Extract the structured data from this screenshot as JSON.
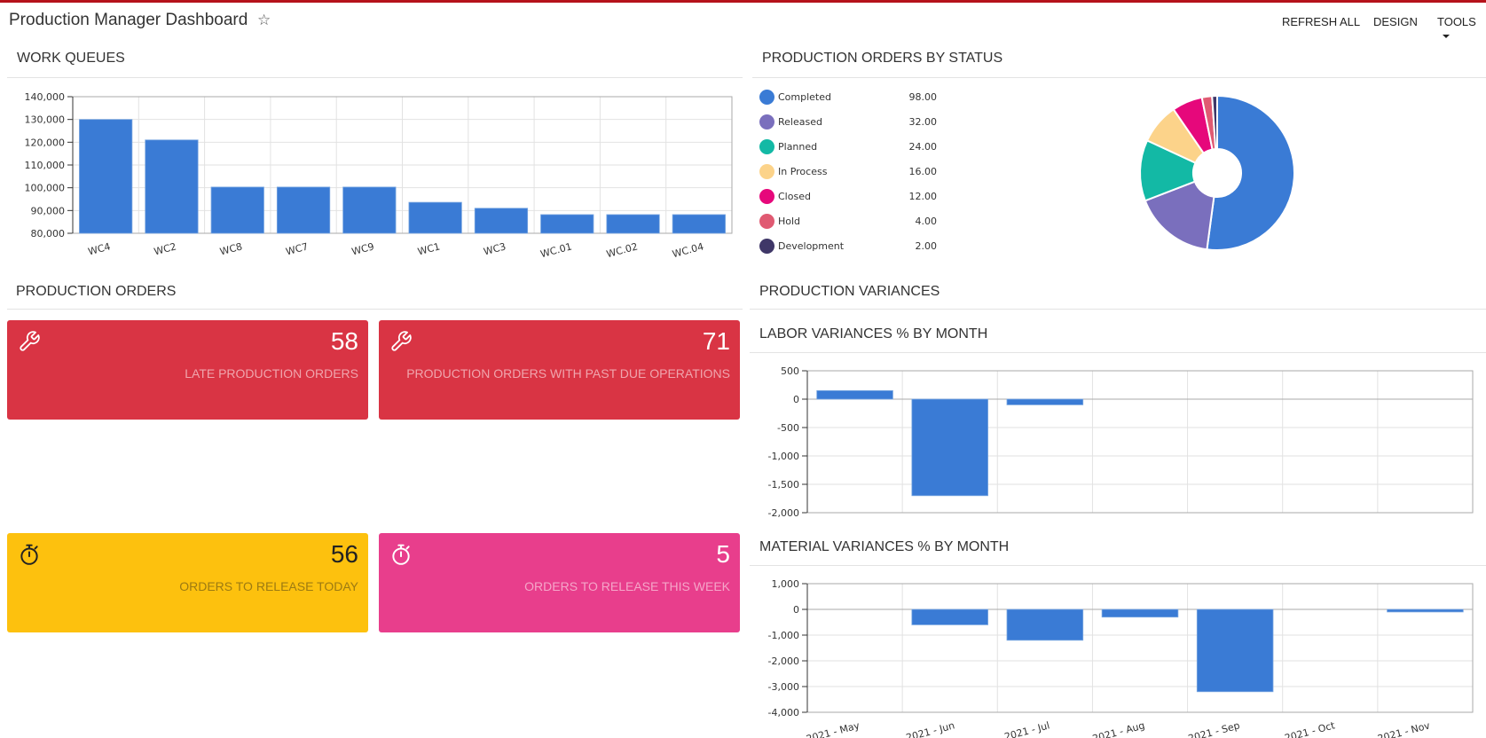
{
  "header": {
    "title": "Production Manager Dashboard",
    "star_icon": "star-outline-icon",
    "actions": [
      {
        "label": "REFRESH ALL"
      },
      {
        "label": "DESIGN"
      },
      {
        "label": "TOOLS",
        "has_dropdown": true
      }
    ]
  },
  "sections": {
    "work_queues": "WORK QUEUES",
    "orders_by_status": "PRODUCTION ORDERS BY STATUS",
    "production_orders": "PRODUCTION ORDERS",
    "production_variances": "PRODUCTION VARIANCES",
    "labor_variances": "LABOR VARIANCES % BY MONTH",
    "material_variances": "MATERIAL VARIANCES % BY MONTH"
  },
  "tiles": [
    {
      "icon": "wrench-icon",
      "value": "58",
      "label": "LATE PRODUCTION ORDERS",
      "color": "#d93444",
      "text_color": "#ffffff",
      "label_color": "#f0a5ad"
    },
    {
      "icon": "wrench-icon",
      "value": "71",
      "label": "PRODUCTION ORDERS WITH PAST DUE OPERATIONS",
      "color": "#d93444",
      "text_color": "#ffffff",
      "label_color": "#f0a5ad"
    },
    {
      "icon": "stopwatch-icon",
      "value": "56",
      "label": "ORDERS TO RELEASE TODAY",
      "color": "#fdc10e",
      "text_color": "#222222",
      "label_color": "#9c7a12"
    },
    {
      "icon": "stopwatch-icon",
      "value": "5",
      "label": "ORDERS TO RELEASE THIS WEEK",
      "color": "#e83e8c",
      "text_color": "#ffffff",
      "label_color": "#f5a6c9"
    }
  ],
  "status_legend": [
    {
      "label": "Completed",
      "value": "98.00",
      "color": "#3a7bd5"
    },
    {
      "label": "Released",
      "value": "32.00",
      "color": "#7a6fbd"
    },
    {
      "label": "Planned",
      "value": "24.00",
      "color": "#13b9a5"
    },
    {
      "label": "In Process",
      "value": "16.00",
      "color": "#fcd38a"
    },
    {
      "label": "Closed",
      "value": "12.00",
      "color": "#e6087b"
    },
    {
      "label": "Hold",
      "value": "4.00",
      "color": "#e05a72"
    },
    {
      "label": "Development",
      "value": "2.00",
      "color": "#3f3768"
    }
  ],
  "chart_data": [
    {
      "id": "work_queues",
      "type": "bar",
      "title": "WORK QUEUES",
      "categories": [
        "WC4",
        "WC2",
        "WC8",
        "WC7",
        "WC9",
        "WC1",
        "WC3",
        "WC.01",
        "WC.02",
        "WC.04"
      ],
      "values": [
        130000,
        121000,
        100300,
        100300,
        100300,
        93600,
        91000,
        88200,
        88200,
        88200
      ],
      "ylim": [
        80000,
        140000
      ],
      "yticks": [
        80000,
        90000,
        100000,
        110000,
        120000,
        130000,
        140000
      ],
      "ytick_labels": [
        "80,000",
        "90,000",
        "100,000",
        "110,000",
        "120,000",
        "130,000",
        "140,000"
      ],
      "grid": true,
      "color": "#3a7bd5"
    },
    {
      "id": "orders_by_status",
      "type": "pie",
      "title": "PRODUCTION ORDERS BY STATUS",
      "donut": true,
      "categories": [
        "Completed",
        "Released",
        "Planned",
        "In Process",
        "Closed",
        "Hold",
        "Development"
      ],
      "values": [
        98,
        32,
        24,
        16,
        12,
        4,
        2
      ],
      "colors": [
        "#3a7bd5",
        "#7a6fbd",
        "#13b9a5",
        "#fcd38a",
        "#e6087b",
        "#e05a72",
        "#3f3768"
      ],
      "legend": "left"
    },
    {
      "id": "labor_variances",
      "type": "bar",
      "title": "LABOR VARIANCES % BY MONTH",
      "categories": [
        "2021 - May",
        "2021 - Jun",
        "2021 - Jul",
        "2021 - Aug",
        "2021 - Sep",
        "2021 - Oct",
        "2021 - Nov"
      ],
      "values": [
        150,
        -1700,
        -100,
        null,
        null,
        null,
        null
      ],
      "ylim": [
        -2000,
        500
      ],
      "yticks": [
        -2000,
        -1500,
        -1000,
        -500,
        0,
        500
      ],
      "ytick_labels": [
        "-2,000",
        "-1,500",
        "-1,000",
        "-500",
        "0",
        "500"
      ],
      "show_xlabels": false,
      "grid": true,
      "color": "#3a7bd5"
    },
    {
      "id": "material_variances",
      "type": "bar",
      "title": "MATERIAL VARIANCES % BY MONTH",
      "categories": [
        "2021 - May",
        "2021 - Jun",
        "2021 - Jul",
        "2021 - Aug",
        "2021 - Sep",
        "2021 - Oct",
        "2021 - Nov"
      ],
      "values": [
        null,
        -600,
        -1200,
        -300,
        -3200,
        null,
        -100
      ],
      "ylim": [
        -4000,
        1000
      ],
      "yticks": [
        -4000,
        -3000,
        -2000,
        -1000,
        0,
        1000
      ],
      "ytick_labels": [
        "-4,000",
        "-3,000",
        "-2,000",
        "-1,000",
        "0",
        "1,000"
      ],
      "show_xlabels": true,
      "grid": true,
      "color": "#3a7bd5"
    }
  ]
}
